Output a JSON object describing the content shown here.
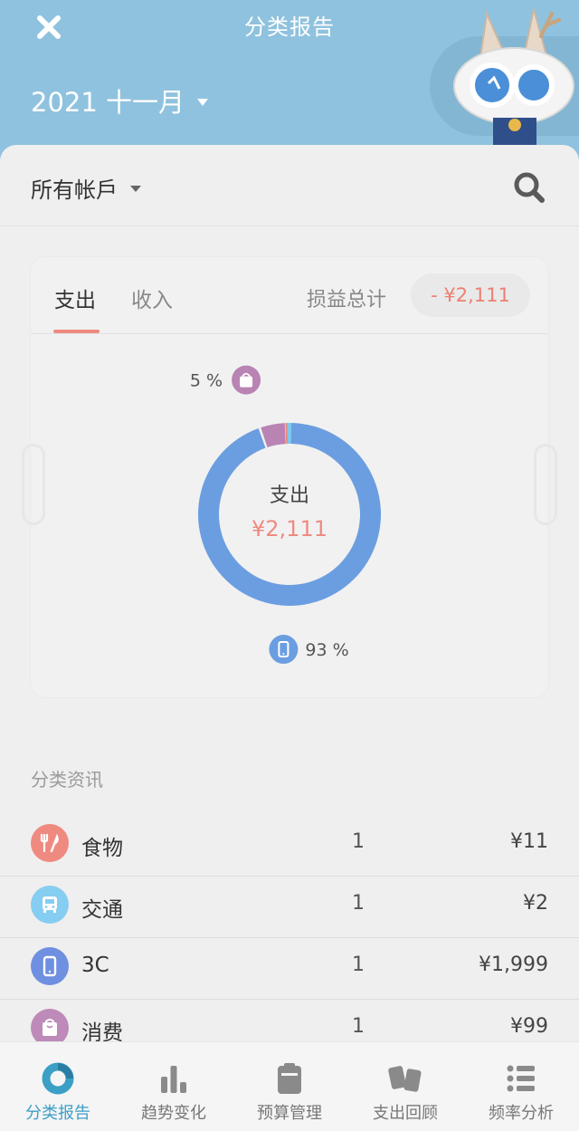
{
  "header": {
    "title": "分类报告",
    "month": "2021 十一月",
    "close_icon": "close-icon",
    "mascot": "cat-mascot-illustration"
  },
  "accounts": {
    "label": "所有帐戶",
    "search_icon": "search-icon"
  },
  "report": {
    "tabs": [
      {
        "label": "支出",
        "active": true
      },
      {
        "label": "收入",
        "active": false
      }
    ],
    "profit_loss_label": "损益总计",
    "profit_loss_value": "- ¥2,111",
    "accent_color": "#ef8a80"
  },
  "chart_data": {
    "type": "pie",
    "center_label": "支出",
    "center_value": "¥2,111",
    "series": [
      {
        "name": "3C",
        "value": 1999,
        "color": "#6b9ee0"
      },
      {
        "name": "消费",
        "value": 99,
        "color": "#b983b3"
      },
      {
        "name": "食物",
        "value": 11,
        "color": "#ef837a"
      },
      {
        "name": "交通",
        "value": 2,
        "color": "#7fc8ee"
      }
    ],
    "percent_labels": [
      {
        "text": "5 %",
        "category": "消费"
      },
      {
        "text": "93 %",
        "category": "3C"
      }
    ]
  },
  "categories": {
    "title": "分类资讯",
    "items": [
      {
        "name": "食物",
        "count": "1",
        "amount": "¥11",
        "icon": "utensils-icon",
        "color": "#ef8a80"
      },
      {
        "name": "交通",
        "count": "1",
        "amount": "¥2",
        "icon": "bus-icon",
        "color": "#86cdf2"
      },
      {
        "name": "3C",
        "count": "1",
        "amount": "¥1,999",
        "icon": "phone-icon",
        "color": "#6f8fe0"
      },
      {
        "name": "消费",
        "count": "1",
        "amount": "¥99",
        "icon": "shopping-bag-icon",
        "color": "#be8ab9"
      }
    ]
  },
  "nav": {
    "items": [
      {
        "label": "分类报告",
        "icon": "donut-chart-icon",
        "active": true
      },
      {
        "label": "趋势变化",
        "icon": "bar-chart-icon",
        "active": false
      },
      {
        "label": "预算管理",
        "icon": "clipboard-icon",
        "active": false
      },
      {
        "label": "支出回顾",
        "icon": "cards-icon",
        "active": false
      },
      {
        "label": "频率分析",
        "icon": "list-icon",
        "active": false
      }
    ],
    "active_color": "#3c9fc6"
  }
}
